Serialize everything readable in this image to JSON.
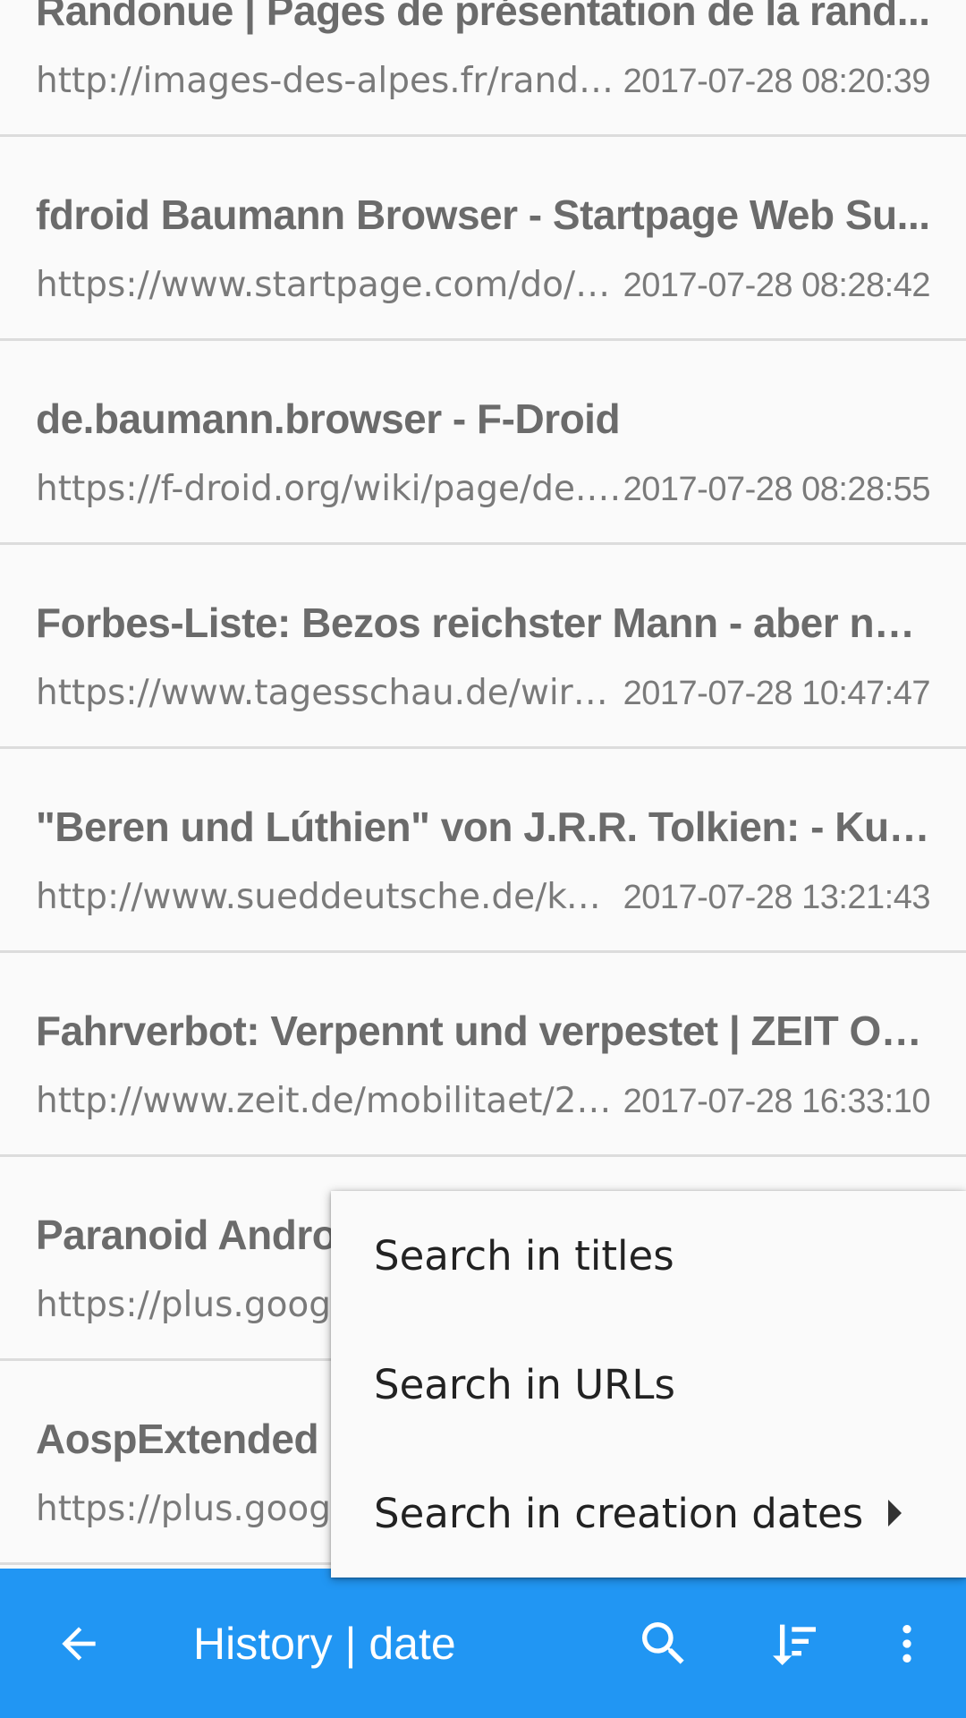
{
  "history": [
    {
      "title": "Randonue | Pages de présentation de la rand...",
      "url": "http://images-des-alpes.fr/rando...",
      "date": "2017-07-28 08:20:39"
    },
    {
      "title": "fdroid Baumann Browser - Startpage Web Su...",
      "url": "https://www.startpage.com/do/se...",
      "date": "2017-07-28 08:28:42"
    },
    {
      "title": "de.baumann.browser - F-Droid",
      "url": "https://f-droid.org/wiki/page/de.b...",
      "date": "2017-07-28 08:28:55"
    },
    {
      "title": "Forbes-Liste: Bezos reichster Mann - aber nur...",
      "url": "https://www.tagesschau.de/wirtsch...",
      "date": "2017-07-28 10:47:47"
    },
    {
      "title": "\"Beren und Lúthien\" von J.R.R. Tolkien: - Kult...",
      "url": "http://www.sueddeutsche.de/kultu...",
      "date": "2017-07-28 13:21:43"
    },
    {
      "title": "Fahrverbot: Verpennt und verpestet | ZEIT ON...",
      "url": "http://www.zeit.de/mobilitaet/2017...",
      "date": "2017-07-28 16:33:10"
    },
    {
      "title": "Paranoid Androi",
      "url": "https://plus.googl",
      "date": ""
    },
    {
      "title": "AospExtended -",
      "url": "https://plus.googl",
      "date": ""
    }
  ],
  "toolbar": {
    "title": "History | date",
    "back_icon": "arrow-back-icon",
    "search_icon": "search-icon",
    "sort_icon": "sort-icon",
    "overflow_icon": "more-vert-icon",
    "color": "#2196f3"
  },
  "popup_menu": {
    "items": [
      {
        "label": "Search in titles",
        "has_submenu": false
      },
      {
        "label": "Search in URLs",
        "has_submenu": false
      },
      {
        "label": "Search in creation dates",
        "has_submenu": true
      }
    ]
  }
}
